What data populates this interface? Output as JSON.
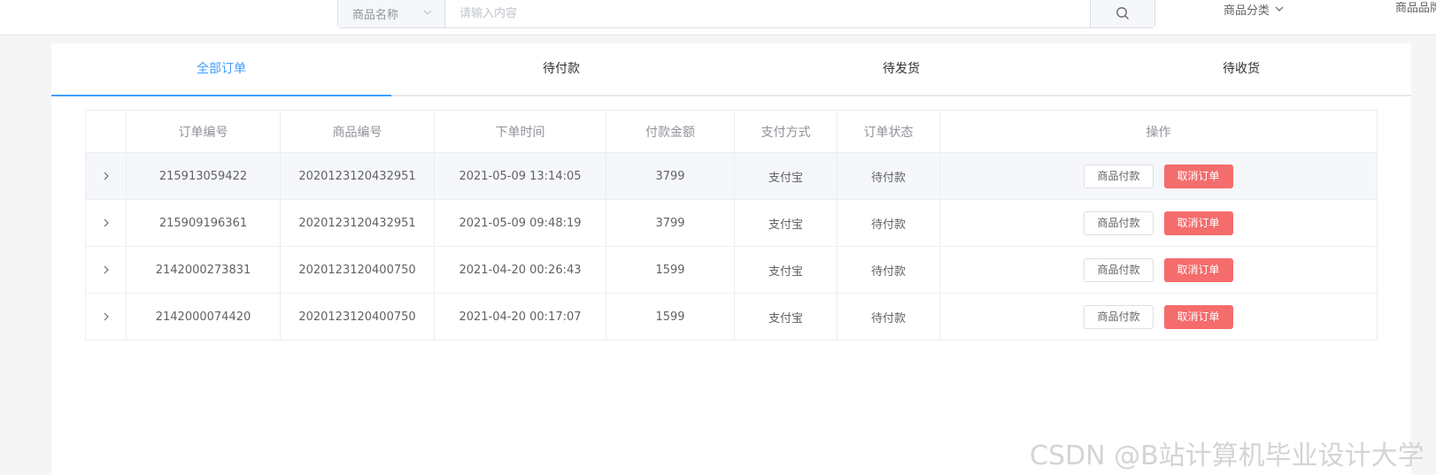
{
  "header": {
    "search_select_label": "商品名称",
    "search_placeholder": "请输入内容",
    "category_label": "商品分类",
    "brand_label": "商品品牌"
  },
  "tabs": [
    {
      "label": "全部订单",
      "active": true
    },
    {
      "label": "待付款",
      "active": false
    },
    {
      "label": "待发货",
      "active": false
    },
    {
      "label": "待收货",
      "active": false
    }
  ],
  "table": {
    "columns": [
      "订单编号",
      "商品编号",
      "下单时间",
      "付款金额",
      "支付方式",
      "订单状态",
      "操作"
    ],
    "rows": [
      {
        "order_no": "215913059422",
        "product_no": "2020123120432951",
        "time": "2021-05-09 13:14:05",
        "amount": "3799",
        "payment": "支付宝",
        "status": "待付款"
      },
      {
        "order_no": "215909196361",
        "product_no": "2020123120432951",
        "time": "2021-05-09 09:48:19",
        "amount": "3799",
        "payment": "支付宝",
        "status": "待付款"
      },
      {
        "order_no": "2142000273831",
        "product_no": "2020123120400750",
        "time": "2021-04-20 00:26:43",
        "amount": "1599",
        "payment": "支付宝",
        "status": "待付款"
      },
      {
        "order_no": "2142000074420",
        "product_no": "2020123120400750",
        "time": "2021-04-20 00:17:07",
        "amount": "1599",
        "payment": "支付宝",
        "status": "待付款"
      }
    ],
    "action_pay_label": "商品付款",
    "action_cancel_label": "取消订单"
  },
  "watermark": "CSDN @B站计算机毕业设计大学",
  "colors": {
    "accent": "#409eff",
    "danger": "#f56c6c"
  }
}
